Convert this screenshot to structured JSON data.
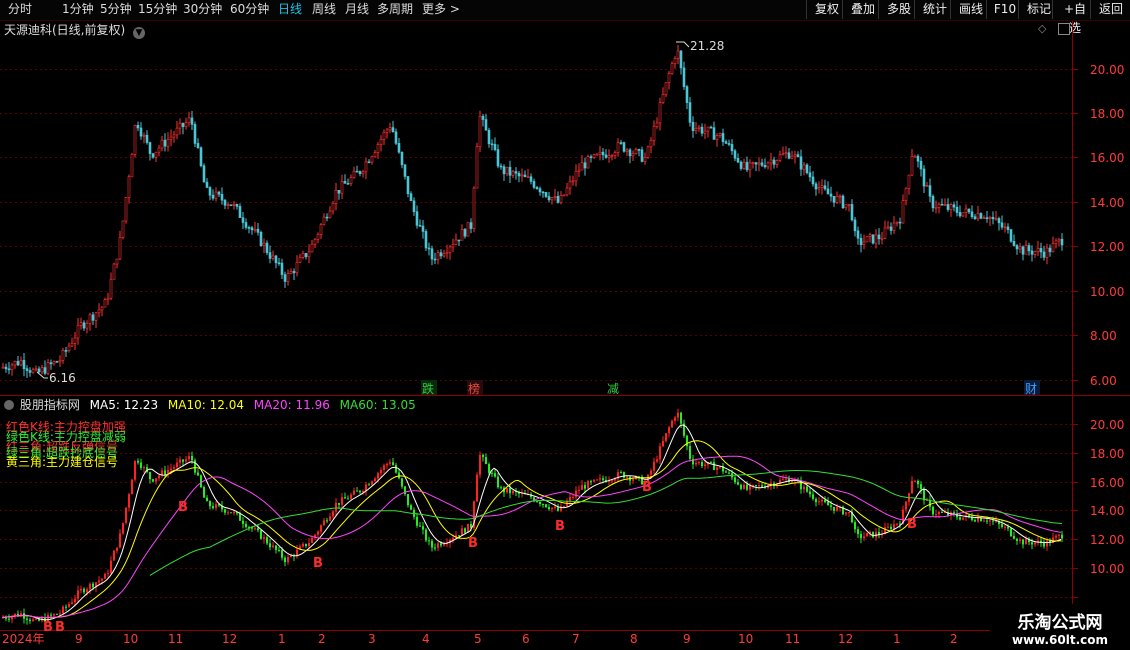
{
  "toolbar": {
    "periods": [
      "分时",
      "1分钟",
      "5分钟",
      "15分钟",
      "30分钟",
      "60分钟",
      "日线",
      "周线",
      "月线",
      "多周期",
      "更多"
    ],
    "active_period": "日线",
    "right_buttons": [
      "复权",
      "叠加",
      "多股",
      "统计",
      "画线",
      "F10",
      "标记",
      "+自选",
      "返回"
    ]
  },
  "main_chart": {
    "title": "天源迪科(日线,前复权)",
    "y_ticks": [
      "20.00",
      "18.00",
      "16.00",
      "14.00",
      "12.00",
      "10.00",
      "8.00",
      "6.00"
    ],
    "high_label": "21.28",
    "low_label": "6.16",
    "event_markers": [
      {
        "text": "跌",
        "color": "#2ecc40"
      },
      {
        "text": "榜",
        "color": "#e74c3c"
      },
      {
        "text": "减",
        "color": "#2ecc40"
      },
      {
        "text": "财",
        "color": "#3aa0ff"
      }
    ]
  },
  "indicator": {
    "name": "股朋指标网",
    "ma_labels": [
      {
        "text": "MA5: 12.23",
        "color": "#ffffff"
      },
      {
        "text": "MA10: 12.04",
        "color": "#ffff00"
      },
      {
        "text": "MA20: 11.96",
        "color": "#ff44ff"
      },
      {
        "text": "MA60: 13.05",
        "color": "#33dd33"
      }
    ],
    "legend": [
      {
        "text": "红色K线:主力控盘加强",
        "color": "#ff3333"
      },
      {
        "text": "绿色K线:主力控盘减弱",
        "color": "#33ee33"
      },
      {
        "text": "红三角:超跌反弹信号",
        "color": "#ff3333"
      },
      {
        "text": "绿三角:超跌抄底信号",
        "color": "#33ee33"
      },
      {
        "text": "黄三角:主力建仓信号",
        "color": "#ffff00"
      }
    ],
    "y_ticks": [
      "20.00",
      "18.00",
      "16.00",
      "14.00",
      "12.00",
      "10.00"
    ],
    "b_signal": "B"
  },
  "x_axis": {
    "labels": [
      "2024年",
      "9",
      "10",
      "11",
      "12",
      "1",
      "2",
      "3",
      "4",
      "5",
      "6",
      "7",
      "8",
      "9",
      "10",
      "11",
      "12",
      "1",
      "2"
    ]
  },
  "watermark": {
    "line1": "乐淘公式网",
    "line2": "www.60lt.com"
  },
  "colors": {
    "up": "#ff3333",
    "down": "#4cc6d6",
    "grid": "#8b0000",
    "axis_text": "#ff3b3b"
  }
}
